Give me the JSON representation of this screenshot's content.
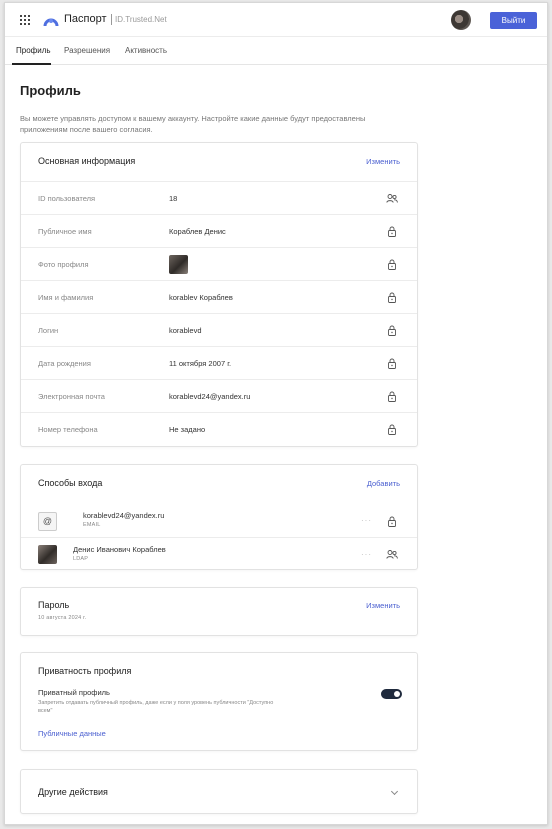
{
  "header": {
    "app_name": "Паспорт",
    "domain": "ID.Trusted.Net",
    "logout_label": "Выйти"
  },
  "tabs": [
    {
      "label": "Профиль"
    },
    {
      "label": "Разрешения"
    },
    {
      "label": "Активность"
    }
  ],
  "page": {
    "title": "Профиль",
    "description": "Вы можете управлять доступом к вашему аккаунту. Настройте какие данные будут предоставлены приложениям после вашего согласия."
  },
  "basic_info": {
    "title": "Основная информация",
    "edit_label": "Изменить",
    "rows": [
      {
        "label": "ID пользователя",
        "value": "18",
        "icon": "user-group-icon"
      },
      {
        "label": "Публичное имя",
        "value": "Кораблев Денис",
        "icon": "lock-icon"
      },
      {
        "label": "Фото профиля",
        "value": "",
        "icon": "lock-icon"
      },
      {
        "label": "Имя и фамилия",
        "value": "korablev Кораблев",
        "icon": "lock-icon"
      },
      {
        "label": "Логин",
        "value": "korablevd",
        "icon": "lock-icon"
      },
      {
        "label": "Дата рождения",
        "value": "11 октября 2007 г.",
        "icon": "lock-icon"
      },
      {
        "label": "Электронная почта",
        "value": "korablevd24@yandex.ru",
        "icon": "lock-icon"
      },
      {
        "label": "Номер телефона",
        "value": "Не задано",
        "icon": "lock-icon"
      }
    ]
  },
  "login_methods": {
    "title": "Способы входа",
    "add_label": "Добавить",
    "items": [
      {
        "main": "korablevd24@yandex.ru",
        "type": "EMAIL",
        "icon": "lock-icon"
      },
      {
        "main": "Денис Иванович Кораблев",
        "type": "LDAP",
        "icon": "user-group-icon"
      }
    ]
  },
  "password": {
    "title": "Пароль",
    "date": "10 августа 2024 г.",
    "edit_label": "Изменить"
  },
  "privacy": {
    "title": "Приватность профиля",
    "label": "Приватный профиль",
    "hint": "Запретить отдавать публичный профиль, даже если у поля уровень публичности \"Доступно всем\"",
    "enabled": true,
    "public_link": "Публичные данные"
  },
  "other": {
    "title": "Другие действия"
  },
  "colors": {
    "accent": "#4a62d8",
    "toggle_on": "#1f2a3d"
  }
}
